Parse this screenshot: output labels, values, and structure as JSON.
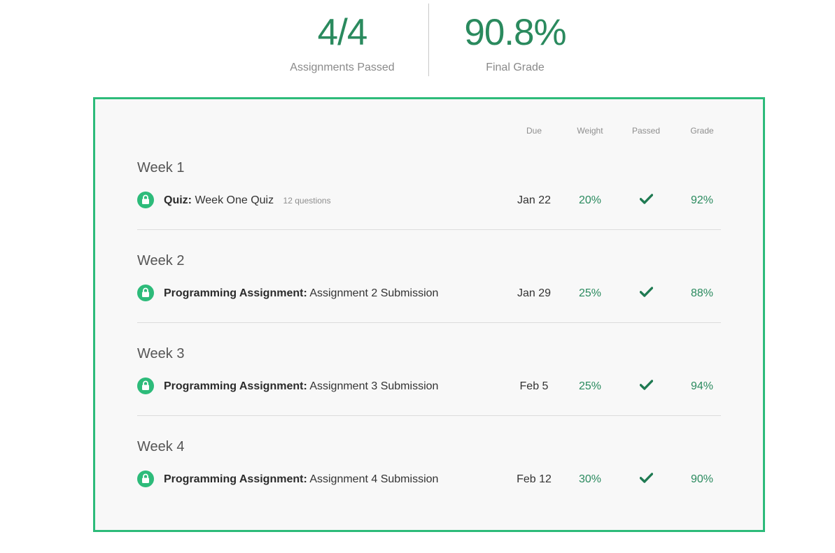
{
  "summary": {
    "assignments_passed_value": "4/4",
    "assignments_passed_label": "Assignments Passed",
    "final_grade_value": "90.8%",
    "final_grade_label": "Final Grade"
  },
  "table": {
    "columns": {
      "due": "Due",
      "weight": "Weight",
      "passed": "Passed",
      "grade": "Grade"
    },
    "weeks": [
      {
        "title": "Week 1",
        "item": {
          "type": "Quiz:",
          "name": "Week One Quiz",
          "meta": "12 questions",
          "due": "Jan 22",
          "weight": "20%",
          "passed": true,
          "grade": "92%"
        }
      },
      {
        "title": "Week 2",
        "item": {
          "type": "Programming Assignment:",
          "name": "Assignment 2 Submission",
          "meta": "",
          "due": "Jan 29",
          "weight": "25%",
          "passed": true,
          "grade": "88%"
        }
      },
      {
        "title": "Week 3",
        "item": {
          "type": "Programming Assignment:",
          "name": "Assignment 3 Submission",
          "meta": "",
          "due": "Feb 5",
          "weight": "25%",
          "passed": true,
          "grade": "94%"
        }
      },
      {
        "title": "Week 4",
        "item": {
          "type": "Programming Assignment:",
          "name": "Assignment 4 Submission",
          "meta": "",
          "due": "Feb 12",
          "weight": "30%",
          "passed": true,
          "grade": "90%"
        }
      }
    ]
  },
  "icons": {
    "item_status": "lock-icon",
    "passed": "checkmark-icon"
  },
  "colors": {
    "accent": "#2dbb7a",
    "accent_text": "#2a8a5e",
    "panel_background": "#f8f8f8"
  }
}
